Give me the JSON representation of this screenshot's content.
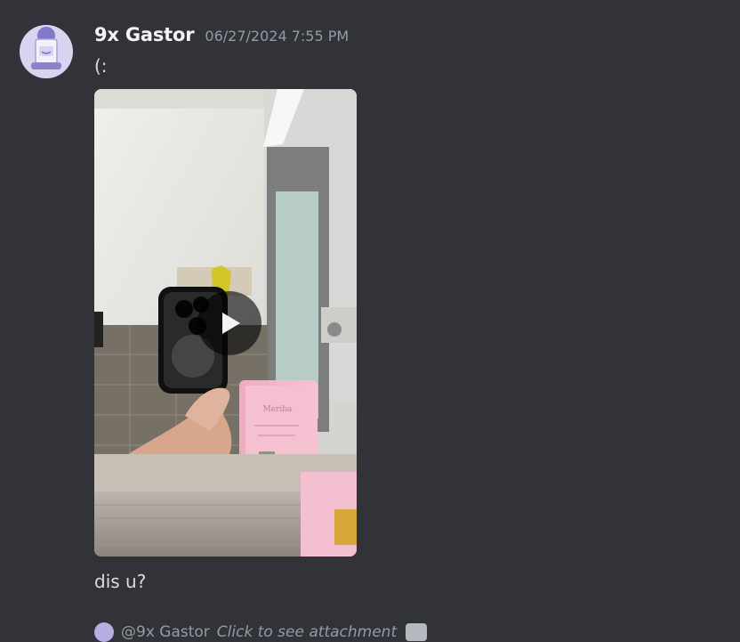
{
  "message": {
    "username": "9x Gastor",
    "timestamp": "06/27/2024 7:55 PM",
    "text": "(:",
    "caption": "dis u?"
  },
  "media": {
    "type": "video",
    "play_label": "Play"
  },
  "reply": {
    "mention": "@9x Gastor",
    "text": "Click to see attachment"
  },
  "colors": {
    "background": "#313338",
    "username": "#f2f3f5",
    "timestamp": "#949ba4",
    "message_text": "#dbdee1"
  }
}
